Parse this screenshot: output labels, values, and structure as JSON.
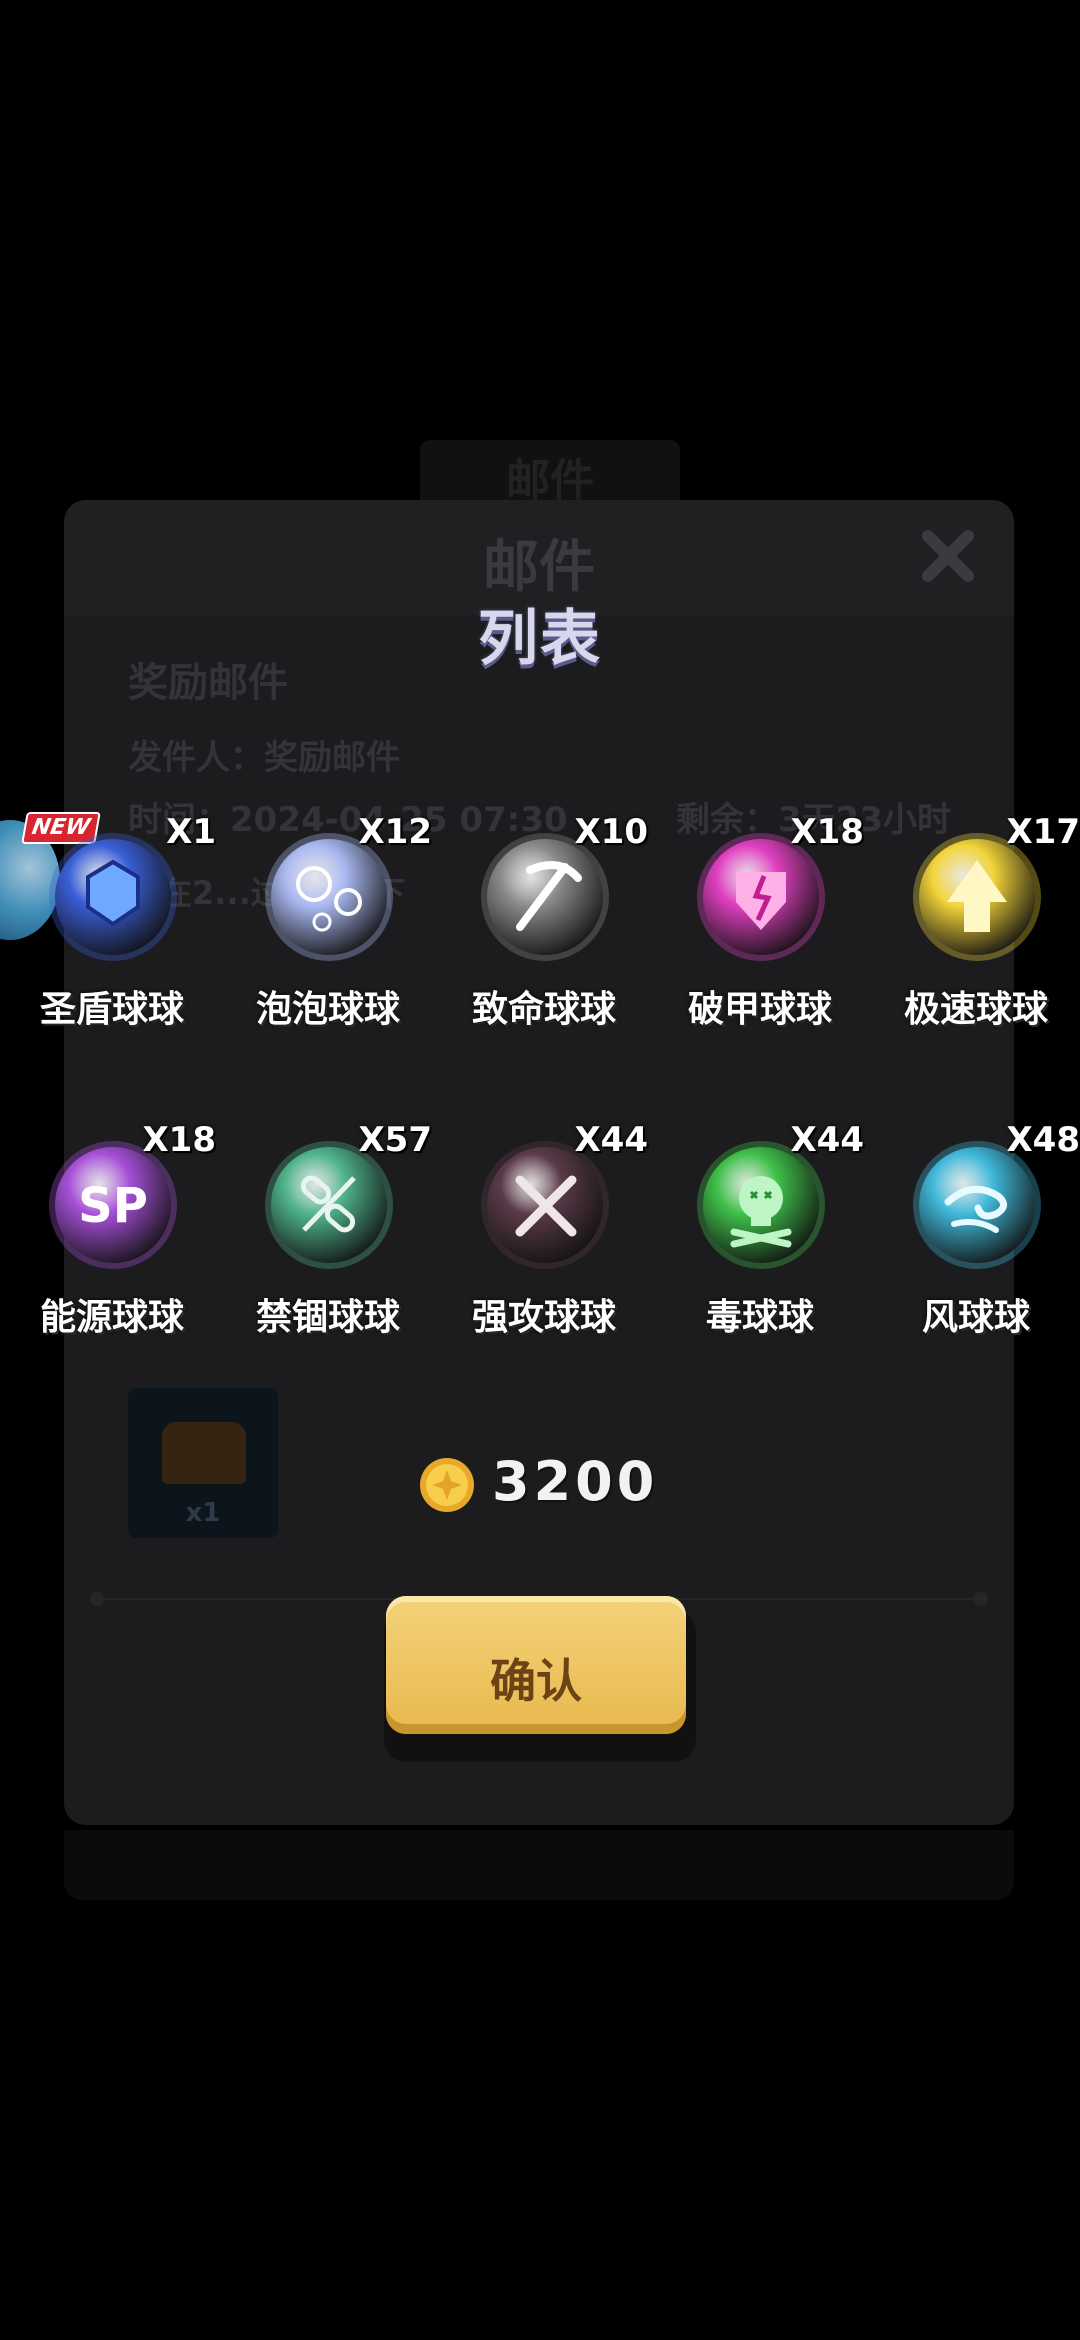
{
  "background_dialog": {
    "tab_label": "邮件",
    "title": "邮件",
    "subject": "奖励邮件",
    "sender": "发件人：奖励邮件",
    "time": "时间：2024-04-25 07:30",
    "remaining": "剩余：3天23小时",
    "note": "您在2...过1...收下",
    "chest_count": "x1"
  },
  "popup": {
    "title": "列表",
    "new_badge": "NEW",
    "rewards": [
      {
        "name": "圣盾球球",
        "qty": "X1",
        "icon": "holy-shield-orb-icon",
        "color": "#3a5fd8"
      },
      {
        "name": "泡泡球球",
        "qty": "X12",
        "icon": "bubble-orb-icon",
        "color": "#a9b8f0"
      },
      {
        "name": "致命球球",
        "qty": "X10",
        "icon": "scythe-orb-icon",
        "color": "#8a8a8a"
      },
      {
        "name": "破甲球球",
        "qty": "X18",
        "icon": "broken-shield-orb-icon",
        "color": "#e040c0"
      },
      {
        "name": "极速球球",
        "qty": "X17",
        "icon": "speed-arrow-orb-icon",
        "color": "#f2d43a"
      },
      {
        "name": "能源球球",
        "qty": "X18",
        "icon": "sp-energy-orb-icon",
        "color": "#a650d8"
      },
      {
        "name": "禁锢球球",
        "qty": "X57",
        "icon": "chain-orb-icon",
        "color": "#4fb38c"
      },
      {
        "name": "强攻球球",
        "qty": "X44",
        "icon": "crossed-swords-orb-icon",
        "color": "#5a3a48"
      },
      {
        "name": "毒球球",
        "qty": "X44",
        "icon": "skull-orb-icon",
        "color": "#3fc04a"
      },
      {
        "name": "风球球",
        "qty": "X48",
        "icon": "wind-orb-icon",
        "color": "#3fb8d8"
      }
    ],
    "coin_value": "3200",
    "confirm_label": "确认"
  }
}
